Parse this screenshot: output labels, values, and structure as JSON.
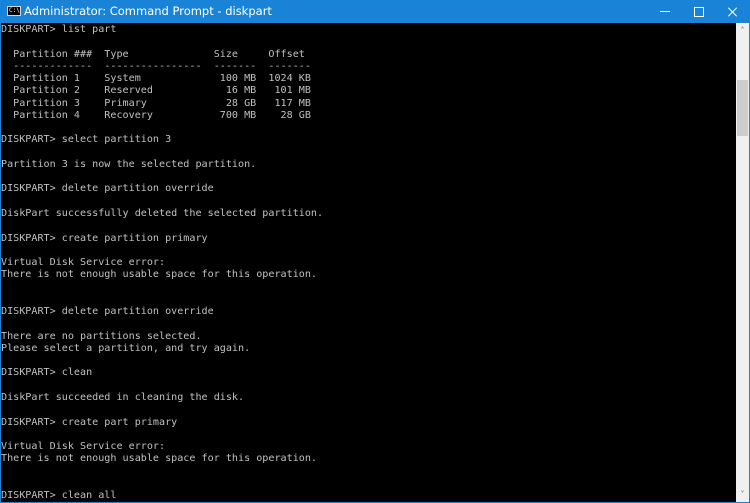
{
  "window": {
    "title": "Administrator: Command Prompt - diskpart",
    "icon": "cmd-icon",
    "controls": {
      "minimize_icon": "minimize-icon",
      "maximize_icon": "maximize-icon",
      "close_icon": "close-icon"
    },
    "accent_color": "#1883d7"
  },
  "console": {
    "text_color": "#c0c0c0",
    "background_color": "#000000",
    "lines": [
      "DISKPART> list part",
      "",
      "  Partition ###  Type              Size     Offset",
      "  -------------  ----------------  -------  -------",
      "  Partition 1    System             100 MB  1024 KB",
      "  Partition 2    Reserved            16 MB   101 MB",
      "  Partition 3    Primary             28 GB   117 MB",
      "  Partition 4    Recovery           700 MB    28 GB",
      "",
      "DISKPART> select partition 3",
      "",
      "Partition 3 is now the selected partition.",
      "",
      "DISKPART> delete partition override",
      "",
      "DiskPart successfully deleted the selected partition.",
      "",
      "DISKPART> create partition primary",
      "",
      "Virtual Disk Service error:",
      "There is not enough usable space for this operation.",
      "",
      "",
      "DISKPART> delete partition override",
      "",
      "There are no partitions selected.",
      "Please select a partition, and try again.",
      "",
      "DISKPART> clean",
      "",
      "DiskPart succeeded in cleaning the disk.",
      "",
      "DISKPART> create part primary",
      "",
      "Virtual Disk Service error:",
      "There is not enough usable space for this operation.",
      "",
      "",
      "DISKPART> clean all"
    ]
  },
  "scrollbar": {
    "up_icon": "chevron-up-icon",
    "down_icon": "chevron-down-icon",
    "thumb_start_fraction": 0.094,
    "thumb_size_fraction": 0.124
  }
}
